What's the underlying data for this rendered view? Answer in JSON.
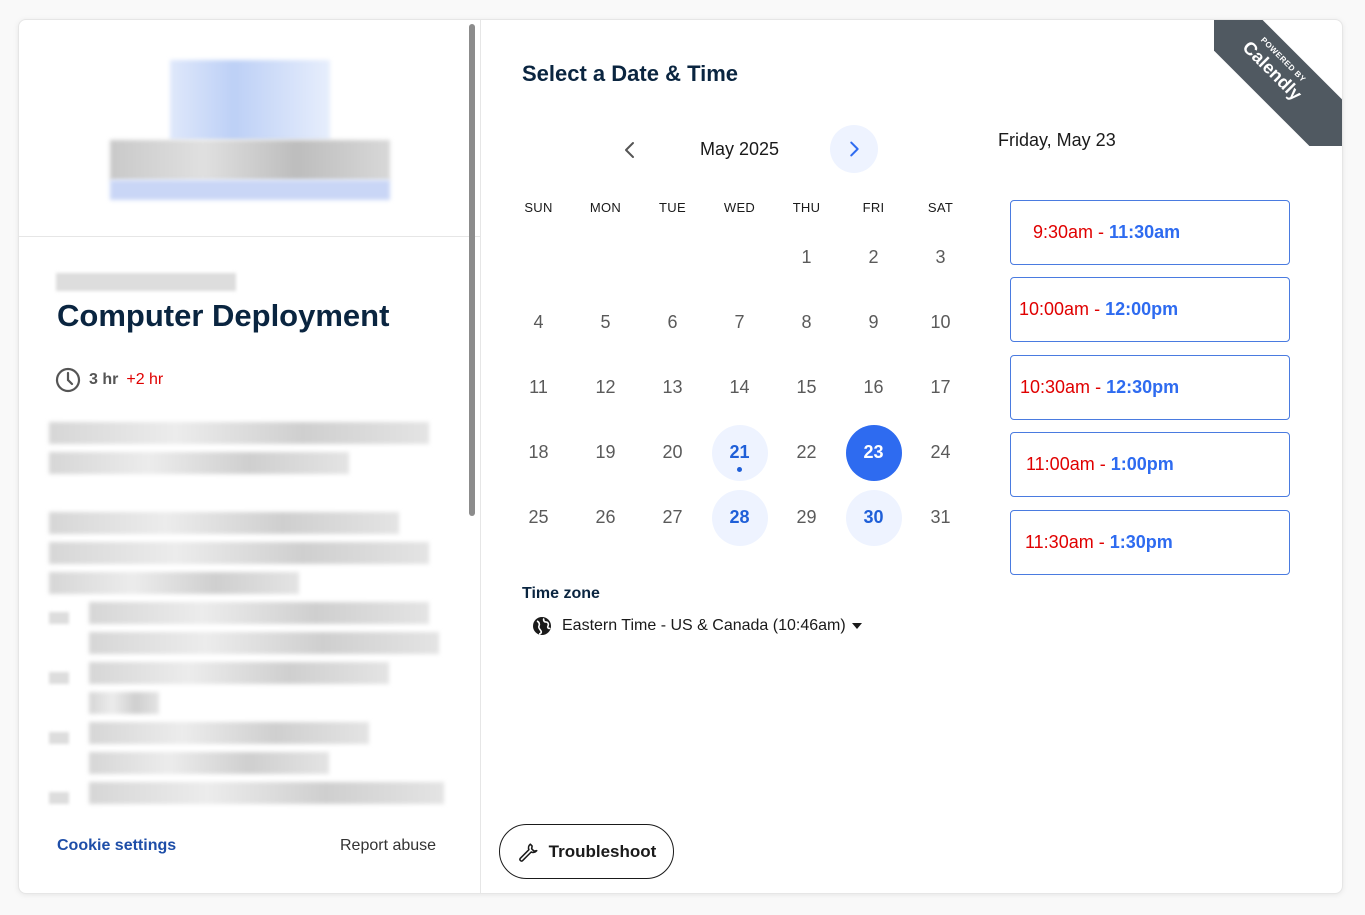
{
  "event": {
    "title": "Computer Deployment",
    "duration": "3 hr",
    "duration_extra": "+2 hr"
  },
  "footer": {
    "cookie_settings": "Cookie settings",
    "report_abuse": "Report abuse"
  },
  "scheduler": {
    "heading": "Select a Date & Time",
    "month_label": "May 2025",
    "weekdays": [
      "SUN",
      "MON",
      "TUE",
      "WED",
      "THU",
      "FRI",
      "SAT"
    ],
    "weeks": [
      [
        "",
        "",
        "",
        "",
        "1",
        "2",
        "3"
      ],
      [
        "4",
        "5",
        "6",
        "7",
        "8",
        "9",
        "10"
      ],
      [
        "11",
        "12",
        "13",
        "14",
        "15",
        "16",
        "17"
      ],
      [
        "18",
        "19",
        "20",
        "21",
        "22",
        "23",
        "24"
      ],
      [
        "25",
        "26",
        "27",
        "28",
        "29",
        "30",
        "31"
      ]
    ],
    "available_days": [
      "21",
      "23",
      "28",
      "30"
    ],
    "today": "21",
    "selected_day": "23",
    "timezone_label": "Time zone",
    "timezone_value": "Eastern Time - US & Canada (10:46am)",
    "selected_date_label": "Friday, May 23",
    "slots": [
      {
        "start": "9:30am",
        "end": "11:30am"
      },
      {
        "start": "10:00am",
        "end": "12:00pm"
      },
      {
        "start": "10:30am",
        "end": "12:30pm"
      },
      {
        "start": "11:00am",
        "end": "1:00pm"
      },
      {
        "start": "11:30am",
        "end": "1:30pm"
      }
    ],
    "troubleshoot_label": "Troubleshoot"
  },
  "ribbon": {
    "powered_by": "POWERED BY",
    "brand": "Calendly"
  },
  "colors": {
    "accent": "#2e6bf0",
    "available_bg": "#eef3ff",
    "slot_start_red": "#e00000",
    "title_navy": "#0a2540",
    "ribbon_gray": "#505961"
  },
  "icons": {
    "prev": "chevron-left-icon",
    "next": "chevron-right-icon",
    "clock": "clock-icon",
    "globe": "globe-icon",
    "wrench": "wrench-icon"
  }
}
